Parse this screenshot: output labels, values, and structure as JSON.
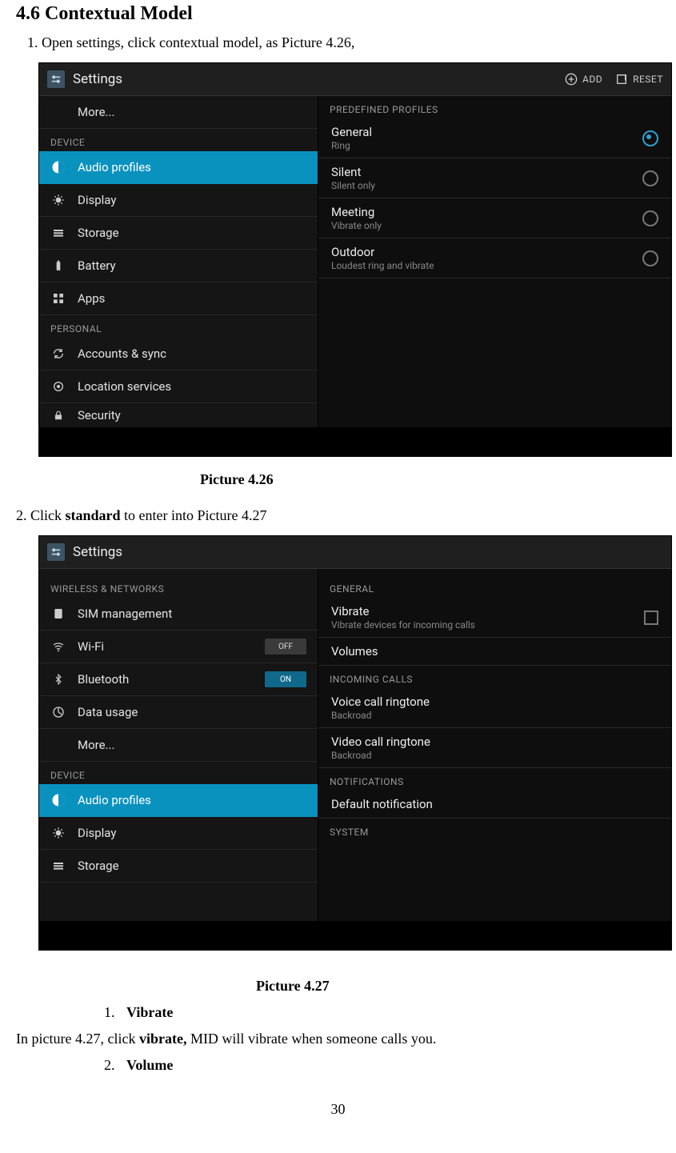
{
  "section_title": "4.6 Contextual Model",
  "line1": "1. Open settings, click contextual model, as Picture 4.26,",
  "caption1": "Picture 4.26",
  "line2_pre": "2.    Click ",
  "line2_bold": "standard",
  "line2_post": " to enter into Picture 4.27",
  "caption2": "Picture 4.27",
  "sub1_num": "1.",
  "sub1_label": "Vibrate",
  "sub1_text_a": "In picture 4.27, click ",
  "sub1_text_b": "vibrate,",
  "sub1_text_c": " MID will vibrate when someone calls you.",
  "sub2_num": "2.",
  "sub2_label": "Volume",
  "page_number": "30",
  "shot1": {
    "title": "Settings",
    "actions": {
      "add": "ADD",
      "reset": "RESET"
    },
    "sidebar": {
      "more": "More...",
      "sec_device": "DEVICE",
      "items": [
        "Audio profiles",
        "Display",
        "Storage",
        "Battery",
        "Apps"
      ],
      "sec_personal": "PERSONAL",
      "personal": [
        "Accounts & sync",
        "Location services",
        "Security"
      ]
    },
    "content": {
      "header": "PREDEFINED PROFILES",
      "profiles": [
        {
          "t": "General",
          "s": "Ring",
          "sel": true
        },
        {
          "t": "Silent",
          "s": "Silent only",
          "sel": false
        },
        {
          "t": "Meeting",
          "s": "Vibrate only",
          "sel": false
        },
        {
          "t": "Outdoor",
          "s": "Loudest ring and vibrate",
          "sel": false
        }
      ]
    }
  },
  "shot2": {
    "title": "Settings",
    "sidebar": {
      "sec_wireless": "WIRELESS & NETWORKS",
      "wireless": [
        {
          "label": "SIM management",
          "ctrl": null
        },
        {
          "label": "Wi-Fi",
          "ctrl": "OFF"
        },
        {
          "label": "Bluetooth",
          "ctrl": "ON"
        },
        {
          "label": "Data usage",
          "ctrl": null
        },
        {
          "label": "More...",
          "ctrl": null
        }
      ],
      "sec_device": "DEVICE",
      "device": [
        "Audio profiles",
        "Display",
        "Storage"
      ]
    },
    "content": {
      "sec_general": "GENERAL",
      "vibrate": {
        "t": "Vibrate",
        "s": "Vibrate devices for incoming calls"
      },
      "volumes": "Volumes",
      "sec_incoming": "INCOMING CALLS",
      "voice": {
        "t": "Voice call ringtone",
        "s": "Backroad"
      },
      "video": {
        "t": "Video call ringtone",
        "s": "Backroad"
      },
      "sec_notif": "NOTIFICATIONS",
      "defnotif": "Default notification",
      "sec_system": "SYSTEM"
    }
  }
}
